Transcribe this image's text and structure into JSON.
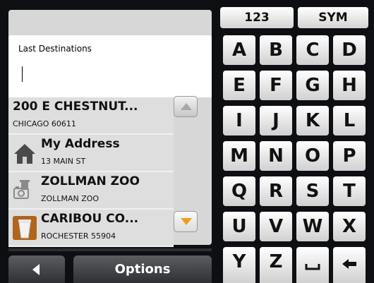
{
  "search": {
    "label": "Last Destinations",
    "value": ""
  },
  "destinations": [
    {
      "title": "200 E CHESTNUT...",
      "subtitle": "CHICAGO 60611",
      "icon": "none"
    },
    {
      "title": "My Address",
      "subtitle": "13 MAIN ST",
      "icon": "house-icon"
    },
    {
      "title": "ZOLLMAN ZOO",
      "subtitle": "ZOLLMAN ZOO",
      "icon": "zoo-icon"
    },
    {
      "title": "CARIBOU CO...",
      "subtitle": "ROCHESTER 55904",
      "icon": "coffee-cup-icon"
    }
  ],
  "scroll": {
    "up_icon": "chevron-up-icon",
    "down_icon": "chevron-down-icon",
    "down_color": "#f39c1d"
  },
  "bottom_bar": {
    "back_icon": "back-arrow-icon",
    "options_label": "Options"
  },
  "keyboard": {
    "mode_keys": [
      "123",
      "SYM"
    ],
    "rows": [
      [
        "A",
        "B",
        "C",
        "D"
      ],
      [
        "E",
        "F",
        "G",
        "H"
      ],
      [
        "I",
        "J",
        "K",
        "L"
      ],
      [
        "M",
        "N",
        "O",
        "P"
      ],
      [
        "Q",
        "R",
        "S",
        "T"
      ],
      [
        "U",
        "V",
        "W",
        "X"
      ],
      [
        "Y",
        "Z"
      ]
    ],
    "space_icon": "space-icon",
    "backspace_icon": "backspace-icon"
  }
}
